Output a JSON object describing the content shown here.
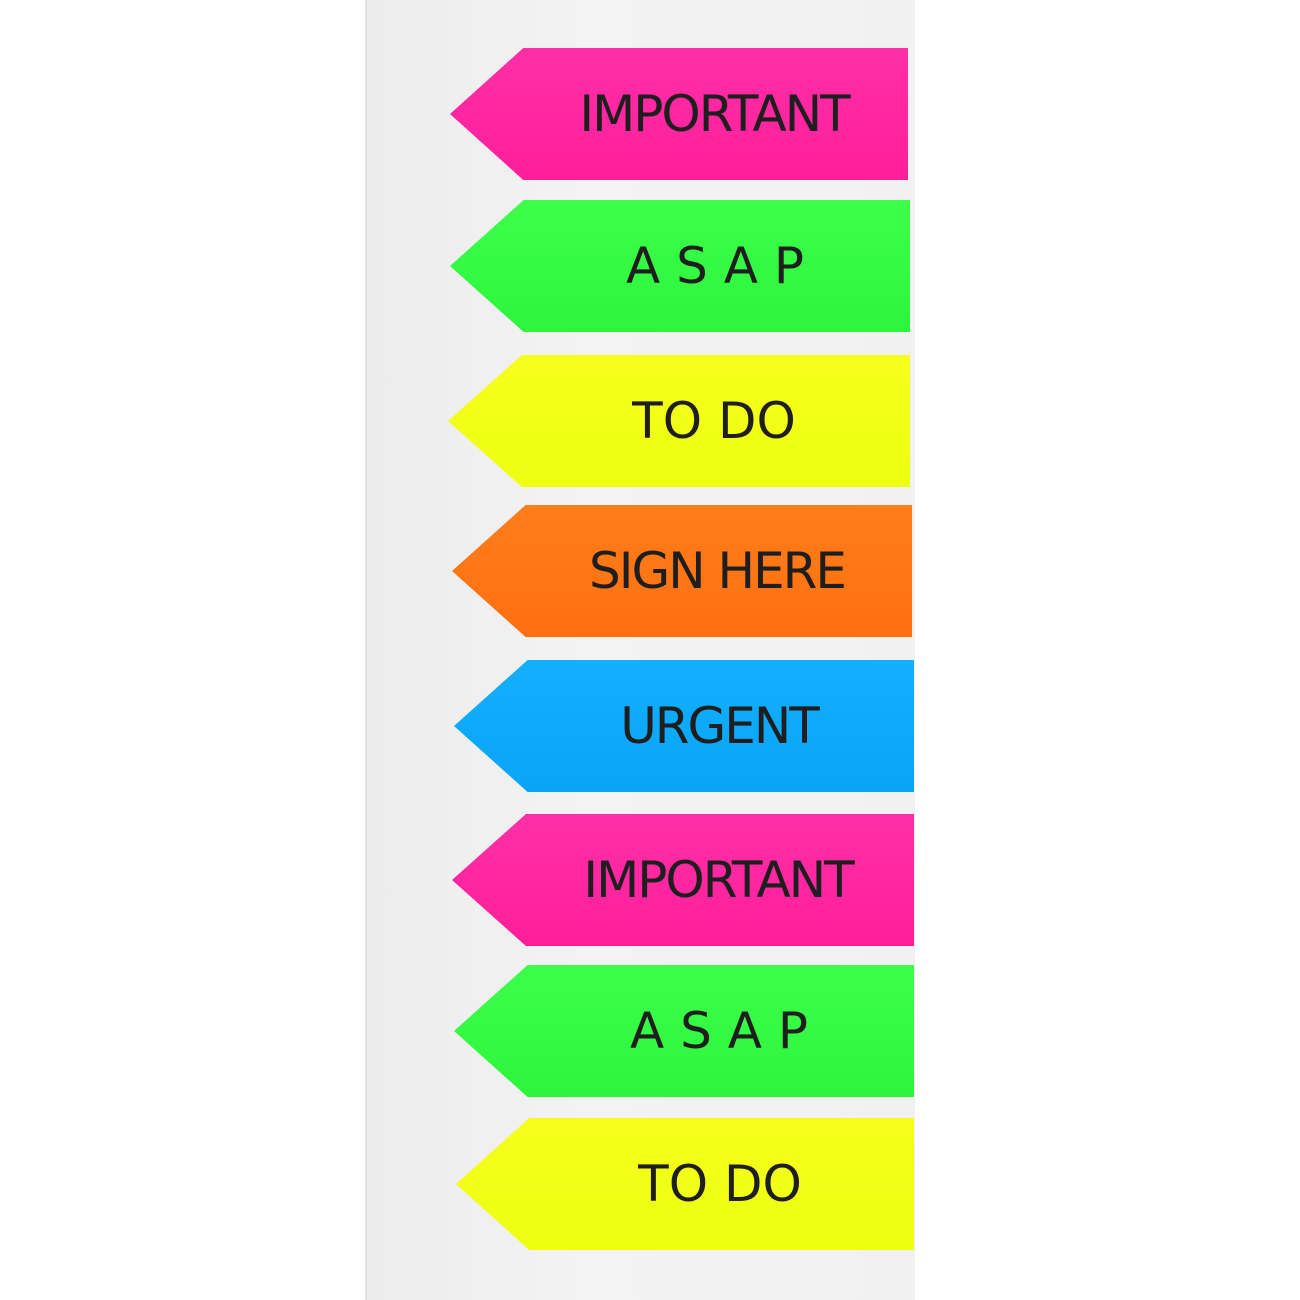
{
  "flags": [
    {
      "label": "IMPORTANT",
      "color": "#ff1e9a"
    },
    {
      "label": "A S A P",
      "color": "#2cf53c"
    },
    {
      "label": "TO DO",
      "color": "#eeff10"
    },
    {
      "label": "SIGN HERE",
      "color": "#ff6f10"
    },
    {
      "label": "URGENT",
      "color": "#0aa4f5"
    },
    {
      "label": "IMPORTANT",
      "color": "#ff1e9a"
    },
    {
      "label": "A S A P",
      "color": "#2cf53c"
    },
    {
      "label": "TO DO",
      "color": "#eeff10"
    }
  ]
}
